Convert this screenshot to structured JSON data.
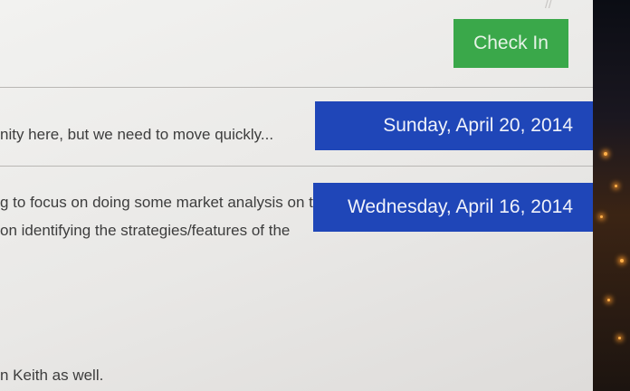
{
  "header": {
    "check_in_label": "Check In"
  },
  "entries": [
    {
      "date": "Sunday, April 20, 2014",
      "lines": [
        "nity here, but we need to move quickly..."
      ]
    },
    {
      "date": "Wednesday, April 16, 2014",
      "lines": [
        "g to focus on doing some market analysis on the",
        "on identifying the strategies/features of the"
      ]
    },
    {
      "lines": [
        "n Keith as well."
      ]
    }
  ],
  "colors": {
    "accent_green": "#3aa84a",
    "date_blue": "#1f46b8"
  }
}
